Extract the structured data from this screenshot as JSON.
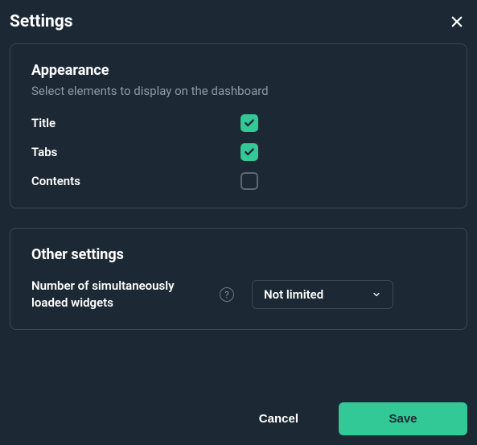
{
  "modal": {
    "title": "Settings"
  },
  "appearance": {
    "title": "Appearance",
    "subtitle": "Select elements to display on the dashboard",
    "items": [
      {
        "label": "Title",
        "checked": true
      },
      {
        "label": "Tabs",
        "checked": true
      },
      {
        "label": "Contents",
        "checked": false
      }
    ]
  },
  "other": {
    "title": "Other settings",
    "widgets": {
      "label": "Number of simultaneously loaded widgets",
      "help": "?",
      "value": "Not limited"
    }
  },
  "footer": {
    "cancel": "Cancel",
    "save": "Save"
  }
}
